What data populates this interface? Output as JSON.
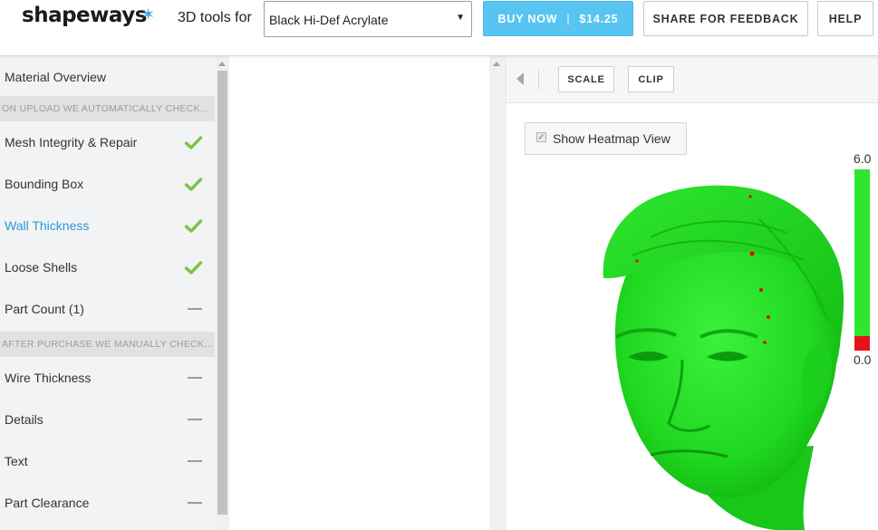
{
  "header": {
    "logo_text": "shapeways",
    "tools_label": "3D tools for",
    "material_select": {
      "value": "Black Hi-Def Acrylate"
    },
    "buy_button": {
      "label": "BUY NOW",
      "price": "$14.25",
      "separator": "|"
    },
    "share_button": "SHARE FOR FEEDBACK",
    "help_button": "HELP"
  },
  "sidebar": {
    "material_overview": "Material Overview",
    "auto_section_header": "ON UPLOAD WE AUTOMATICALLY CHECK...",
    "auto_checks": [
      {
        "label": "Mesh Integrity & Repair",
        "status": "check",
        "active": false
      },
      {
        "label": "Bounding Box",
        "status": "check",
        "active": false
      },
      {
        "label": "Wall Thickness",
        "status": "check",
        "active": true
      },
      {
        "label": "Loose Shells",
        "status": "check",
        "active": false
      },
      {
        "label": "Part Count (1)",
        "status": "dash",
        "active": false
      }
    ],
    "manual_section_header": "AFTER PURCHASE WE MANUALLY CHECK...",
    "manual_checks": [
      {
        "label": "Wire Thickness",
        "status": "dash"
      },
      {
        "label": "Details",
        "status": "dash"
      },
      {
        "label": "Text",
        "status": "dash"
      },
      {
        "label": "Part Clearance",
        "status": "dash"
      }
    ]
  },
  "viewer": {
    "toolbar": {
      "scale_button": "SCALE",
      "clip_button": "CLIP"
    },
    "heatmap_toggle": {
      "label": "Show Heatmap View",
      "checked": true
    },
    "heatmap_scale": {
      "max_label": "6.0",
      "min_label": "0.0",
      "fraction_green": 0.92
    }
  },
  "colors": {
    "accent_blue": "#2a98d8",
    "buy_button": "#57c4f1",
    "check_green": "#7ac143",
    "heatmap_green": "#2fe62f",
    "heatmap_red": "#e8121c"
  },
  "icons": {
    "logo_star": "asterisk-star-icon",
    "status_ok": "checkmark-icon",
    "status_pending": "dash-icon",
    "collapse": "triangle-left-icon",
    "dropdown": "caret-down-icon"
  }
}
